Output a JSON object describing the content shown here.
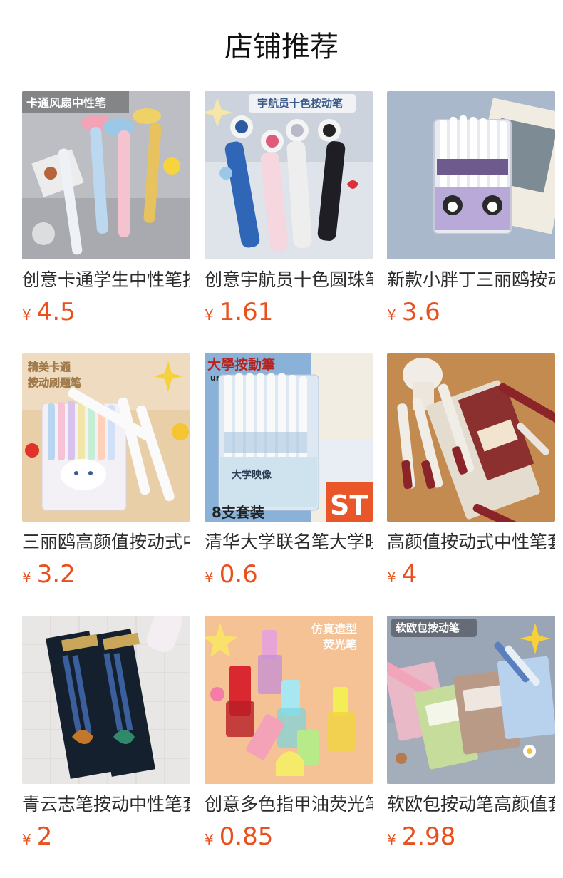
{
  "page": {
    "title": "店铺推荐"
  },
  "currency_symbol": "¥",
  "products": [
    {
      "name": "创意卡通学生中性笔按动",
      "price": "4.5",
      "image_caption": "卡通风扇中性笔",
      "icon": "fan-pen-product-image"
    },
    {
      "name": "创意宇航员十色圆珠笔",
      "price": "1.61",
      "image_caption": "宇航员十色按动笔",
      "icon": "astronaut-pen-product-image"
    },
    {
      "name": "新款小胖丁三丽鸥按动笔",
      "price": "3.6",
      "image_caption": "",
      "icon": "kuromi-pen-box-product-image"
    },
    {
      "name": "三丽鸥高颜值按动式中性笔",
      "price": "3.2",
      "image_caption": "精美卡通\n按动刷题笔",
      "icon": "sanrio-pen-box-product-image"
    },
    {
      "name": "清华大学联名笔大学映像",
      "price": "0.6",
      "image_caption": "大學按動筆\nuniversitygel pen\n8支套装",
      "icon": "university-pen-set-product-image"
    },
    {
      "name": "高颜值按动式中性笔套装",
      "price": "4",
      "image_caption": "",
      "icon": "red-pen-set-product-image"
    },
    {
      "name": "青云志笔按动中性笔套装",
      "price": "2",
      "image_caption": "",
      "icon": "qingyunzhi-pen-pack-product-image"
    },
    {
      "name": "创意多色指甲油荧光笔",
      "price": "0.85",
      "image_caption": "仿真造型\n荧光笔",
      "icon": "nail-polish-highlighter-product-image"
    },
    {
      "name": "软欧包按动笔高颜值套装",
      "price": "2.98",
      "image_caption": "软欧包按动笔",
      "icon": "bread-pen-box-product-image"
    }
  ]
}
